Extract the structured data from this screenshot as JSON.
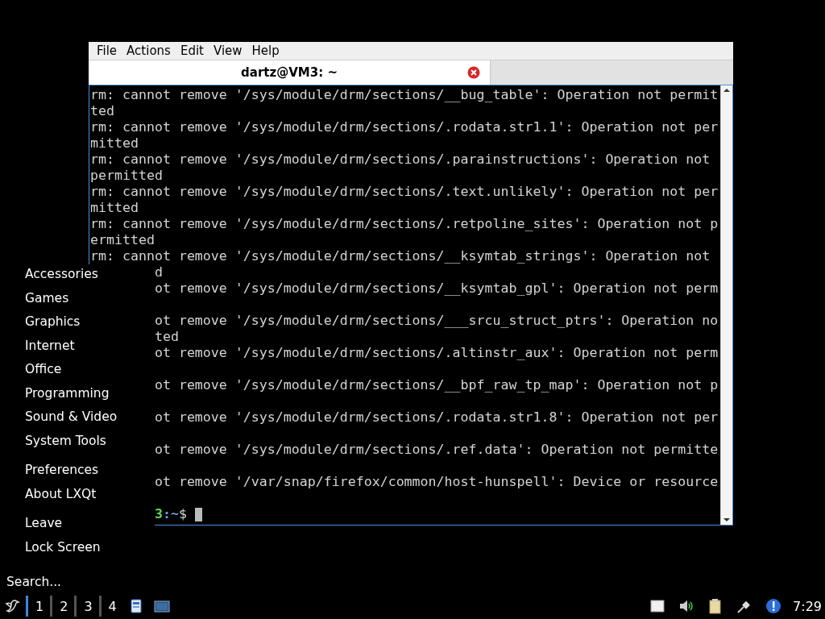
{
  "terminal": {
    "menu": [
      "File",
      "Actions",
      "Edit",
      "View",
      "Help"
    ],
    "tab": {
      "title": "dartz@VM3: ~"
    },
    "lines": [
      {
        "kind": "full",
        "text": "rm: cannot remove '/sys/module/drm/sections/__bug_table': Operation not permit"
      },
      {
        "kind": "full",
        "text": "ted"
      },
      {
        "kind": "full",
        "text": "rm: cannot remove '/sys/module/drm/sections/.rodata.str1.1': Operation not per"
      },
      {
        "kind": "full",
        "text": "mitted"
      },
      {
        "kind": "full",
        "text": "rm: cannot remove '/sys/module/drm/sections/.parainstructions': Operation not"
      },
      {
        "kind": "full",
        "text": "permitted"
      },
      {
        "kind": "full",
        "text": "rm: cannot remove '/sys/module/drm/sections/.text.unlikely': Operation not per"
      },
      {
        "kind": "full",
        "text": "mitted"
      },
      {
        "kind": "full",
        "text": "rm: cannot remove '/sys/module/drm/sections/.retpoline_sites': Operation not p"
      },
      {
        "kind": "full",
        "text": "ermitted"
      },
      {
        "kind": "full",
        "text": "rm: cannot remove '/sys/module/drm/sections/__ksymtab_strings': Operation not"
      },
      {
        "kind": "clipped",
        "text": "d"
      },
      {
        "kind": "clipped",
        "text": "ot remove '/sys/module/drm/sections/__ksymtab_gpl': Operation not perm"
      },
      {
        "kind": "hidden"
      },
      {
        "kind": "clipped",
        "text": "ot remove '/sys/module/drm/sections/___srcu_struct_ptrs': Operation no"
      },
      {
        "kind": "clipped",
        "text": "ted"
      },
      {
        "kind": "clipped",
        "text": "ot remove '/sys/module/drm/sections/.altinstr_aux': Operation not perm"
      },
      {
        "kind": "hidden"
      },
      {
        "kind": "clipped",
        "text": "ot remove '/sys/module/drm/sections/__bpf_raw_tp_map': Operation not p"
      },
      {
        "kind": "hidden"
      },
      {
        "kind": "clipped",
        "text": "ot remove '/sys/module/drm/sections/.rodata.str1.8': Operation not per"
      },
      {
        "kind": "hidden"
      },
      {
        "kind": "clipped",
        "text": "ot remove '/sys/module/drm/sections/.ref.data': Operation not permitte"
      },
      {
        "kind": "hidden"
      },
      {
        "kind": "clipped",
        "text": "ot remove '/var/snap/firefox/common/host-hunspell': Device or resource"
      },
      {
        "kind": "hidden"
      }
    ],
    "prompt": {
      "host": "3",
      "path": ":~",
      "symbol": "$"
    }
  },
  "start_menu": {
    "groups": [
      [
        "Accessories",
        "Games",
        "Graphics",
        "Internet",
        "Office",
        "Programming",
        "Sound & Video",
        "System Tools"
      ],
      [
        "Preferences",
        "About LXQt"
      ],
      [
        "Leave",
        "Lock Screen"
      ]
    ],
    "search": {
      "placeholder": "Search..."
    }
  },
  "taskbar": {
    "desktops": [
      {
        "label": "1",
        "selected": true
      },
      {
        "label": "2",
        "selected": false
      },
      {
        "label": "3",
        "selected": false
      },
      {
        "label": "4",
        "selected": false
      }
    ],
    "clock": "7:29"
  }
}
